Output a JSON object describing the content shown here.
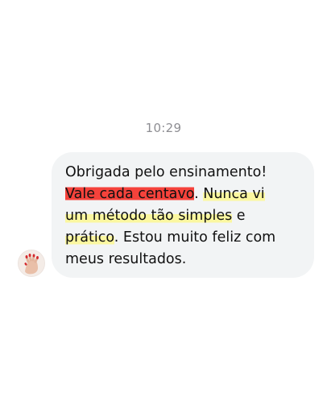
{
  "chat": {
    "timestamp": "10:29",
    "avatar_icon": "red-nails-hand-avatar",
    "colors": {
      "bubble_bg": "#f2f4f5",
      "highlight_red": "#f5423b",
      "highlight_yellow": "#fbf7a0",
      "timestamp_text": "#8e8e93"
    },
    "message": {
      "line1": "Obrigada pelo ensinamento!",
      "line2_red": "Vale cada centavo",
      "line2_dot": ". ",
      "line2_yellow": "Nunca vi",
      "line3_yellow": "um método tão simples",
      "line3_rest": " e",
      "line4_yellow": "prático",
      "line4_rest": ". Estou muito feliz com",
      "line5": "meus resultados."
    }
  }
}
